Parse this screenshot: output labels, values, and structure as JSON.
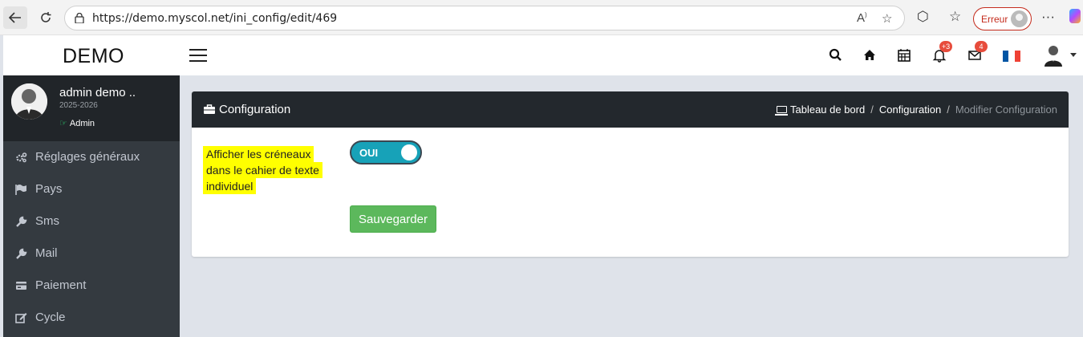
{
  "browser": {
    "url": "https://demo.myscol.net/ini_config/edit/469",
    "error_label": "Erreur"
  },
  "header": {
    "brand": "DEMO",
    "notifications_badge": "+3",
    "messages_badge": "4",
    "flag_colors": [
      "#0055a4",
      "#ffffff",
      "#ef4135"
    ]
  },
  "profile": {
    "name": "admin demo ..",
    "year": "2025-2026",
    "role": "Admin"
  },
  "sidebar": {
    "items": [
      {
        "label": "Réglages généraux",
        "icon": "cogs-icon"
      },
      {
        "label": "Pays",
        "icon": "flag-icon"
      },
      {
        "label": "Sms",
        "icon": "wrench-icon"
      },
      {
        "label": "Mail",
        "icon": "wrench-icon"
      },
      {
        "label": "Paiement",
        "icon": "credit-card-icon"
      },
      {
        "label": "Cycle",
        "icon": "edit-icon"
      }
    ]
  },
  "card": {
    "title": "Configuration",
    "breadcrumb": [
      "Tableau de bord",
      "Configuration",
      "Modifier Configuration"
    ]
  },
  "form": {
    "label_lines": [
      "Afficher les créneaux",
      "dans le cahier de texte",
      "individuel"
    ],
    "toggle_state": "OUI",
    "toggle_on": true,
    "save_label": "Sauvegarder"
  },
  "colors": {
    "sidebar_bg": "#343a40",
    "card_header_bg": "#23282d",
    "toggle_on": "#17a2b8",
    "save_button": "#5cb85c",
    "highlight": "#ffff00"
  }
}
